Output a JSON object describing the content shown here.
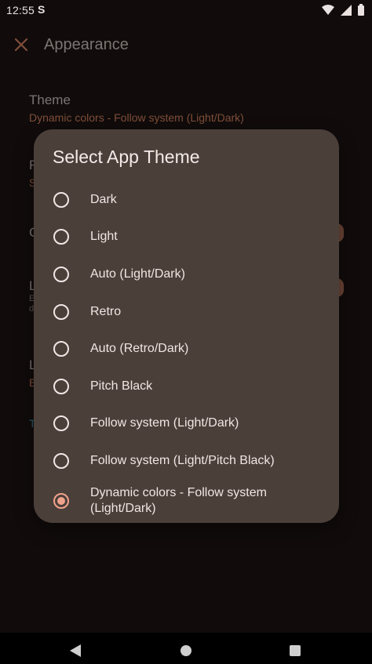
{
  "status_bar": {
    "time": "12:55",
    "notification_icon": "S",
    "icons": [
      "wifi-icon",
      "signal-icon",
      "battery-icon"
    ]
  },
  "app_bar": {
    "close_icon": "close-icon",
    "title": "Appearance"
  },
  "background_settings": {
    "theme": {
      "title": "Theme",
      "summary": "Dynamic colors - Follow system (Light/Dark)"
    },
    "partial_items": [
      {
        "title": "F",
        "summary": "S"
      },
      {
        "title": "C"
      },
      {
        "title": "L",
        "summary": "E",
        "desc2": "d"
      },
      {
        "title": "L",
        "summary": "E"
      },
      {
        "title": "T"
      }
    ]
  },
  "dialog": {
    "title": "Select App Theme",
    "options": [
      {
        "label": "Dark",
        "selected": false
      },
      {
        "label": "Light",
        "selected": false
      },
      {
        "label": "Auto (Light/Dark)",
        "selected": false
      },
      {
        "label": "Retro",
        "selected": false
      },
      {
        "label": "Auto (Retro/Dark)",
        "selected": false
      },
      {
        "label": "Pitch Black",
        "selected": false
      },
      {
        "label": "Follow system (Light/Dark)",
        "selected": false
      },
      {
        "label": "Follow system (Light/Pitch Black)",
        "selected": false
      },
      {
        "label": "Dynamic colors - Follow system (Light/Dark)",
        "selected": true
      }
    ]
  },
  "colors": {
    "accent": "#f1a28b",
    "dialog_bg": "#4b3f3a",
    "page_bg": "#1b1312"
  }
}
